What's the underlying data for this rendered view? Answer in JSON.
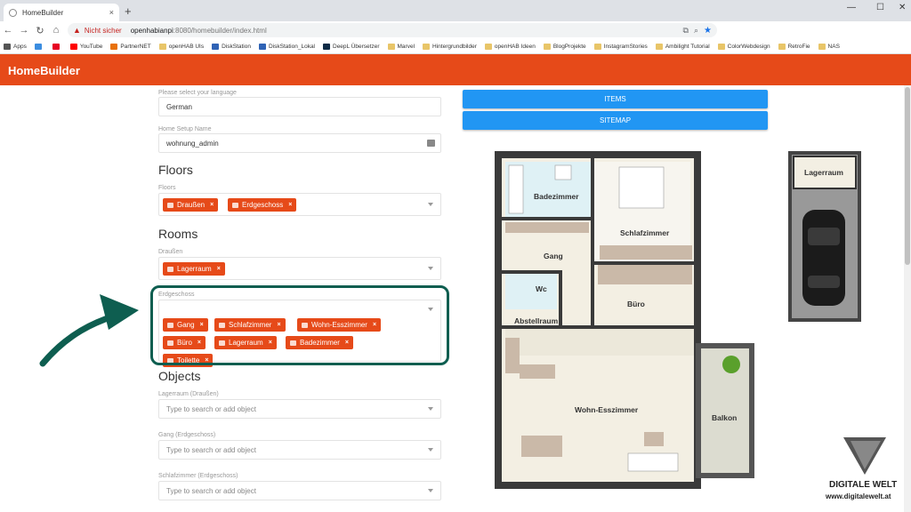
{
  "browser": {
    "tab_title": "HomeBuilder",
    "tab_close": "×",
    "new_tab": "+",
    "security_label": "Nicht sicher",
    "url_host": "openhabianpi",
    "url_rest": ":8080/homebuilder/index.html",
    "bookmarks": [
      {
        "label": "Apps",
        "color": "#555"
      },
      {
        "label": "",
        "color": "#3b8de0"
      },
      {
        "label": "",
        "color": "#e60023"
      },
      {
        "label": "YouTube",
        "color": "#ff0000"
      },
      {
        "label": "PartnerNET",
        "color": "#e8710a"
      },
      {
        "label": "openHAB UIs",
        "color": "#e8c568"
      },
      {
        "label": "DiskStation",
        "color": "#2f63b5"
      },
      {
        "label": "DiskStation_Lokal",
        "color": "#2f63b5"
      },
      {
        "label": "DeepL Übersetzer",
        "color": "#0f2b46"
      },
      {
        "label": "Marvel",
        "color": "#e8c568"
      },
      {
        "label": "Hintergrundbilder",
        "color": "#e8c568"
      },
      {
        "label": "openHAB Ideen",
        "color": "#e8c568"
      },
      {
        "label": "BlogProjekte",
        "color": "#e8c568"
      },
      {
        "label": "InstagramStories",
        "color": "#e8c568"
      },
      {
        "label": "Ambilight Tutorial",
        "color": "#e8c568"
      },
      {
        "label": "ColorWebdesign",
        "color": "#e8c568"
      },
      {
        "label": "RetroFie",
        "color": "#e8c568"
      },
      {
        "label": "NAS",
        "color": "#e8c568"
      }
    ]
  },
  "app": {
    "title": "HomeBuilder",
    "accent": "#e64a19",
    "button_color": "#2196f3"
  },
  "form": {
    "language_label": "Please select your language",
    "language_value": "German",
    "setup_label": "Home Setup Name",
    "setup_value": "wohnung_admin",
    "floors_heading": "Floors",
    "floors_label": "Floors",
    "floors": [
      {
        "label": "Draußen",
        "icon": "tree-icon"
      },
      {
        "label": "Erdgeschoss",
        "icon": "house-icon"
      }
    ],
    "rooms_heading": "Rooms",
    "draussen_label": "Draußen",
    "draussen_rooms": [
      {
        "label": "Lagerraum",
        "icon": "tools-icon"
      }
    ],
    "erdgeschoss_label": "Erdgeschoss",
    "erdgeschoss_rooms": [
      {
        "label": "Gang",
        "icon": "door-icon"
      },
      {
        "label": "Schlafzimmer",
        "icon": "bed-icon"
      },
      {
        "label": "Wohn-Esszimmer",
        "icon": "sofa-icon"
      },
      {
        "label": "Büro",
        "icon": "desk-icon"
      },
      {
        "label": "Lagerraum",
        "icon": "tools-icon"
      },
      {
        "label": "Badezimmer",
        "icon": "bath-icon"
      },
      {
        "label": "Toilette",
        "icon": "toilet-icon"
      }
    ],
    "objects_heading": "Objects",
    "object_fields": [
      {
        "label": "Lagerraum (Draußen)",
        "placeholder": "Type to search or add object"
      },
      {
        "label": "Gang (Erdgeschoss)",
        "placeholder": "Type to search or add object"
      },
      {
        "label": "Schlafzimmer (Erdgeschoss)",
        "placeholder": "Type to search or add object"
      }
    ]
  },
  "actions": {
    "items_label": "ITEMS",
    "sitemap_label": "SITEMAP"
  },
  "floorplan": {
    "rooms": [
      "Badezimmer",
      "Schlafzimmer",
      "Gang",
      "Wc",
      "Abstellraum",
      "Büro",
      "Wohn-Esszimmer",
      "Balkon",
      "Lagerraum"
    ]
  },
  "branding": {
    "name": "DIGITALE WELT",
    "url": "www.digitalewelt.at"
  }
}
